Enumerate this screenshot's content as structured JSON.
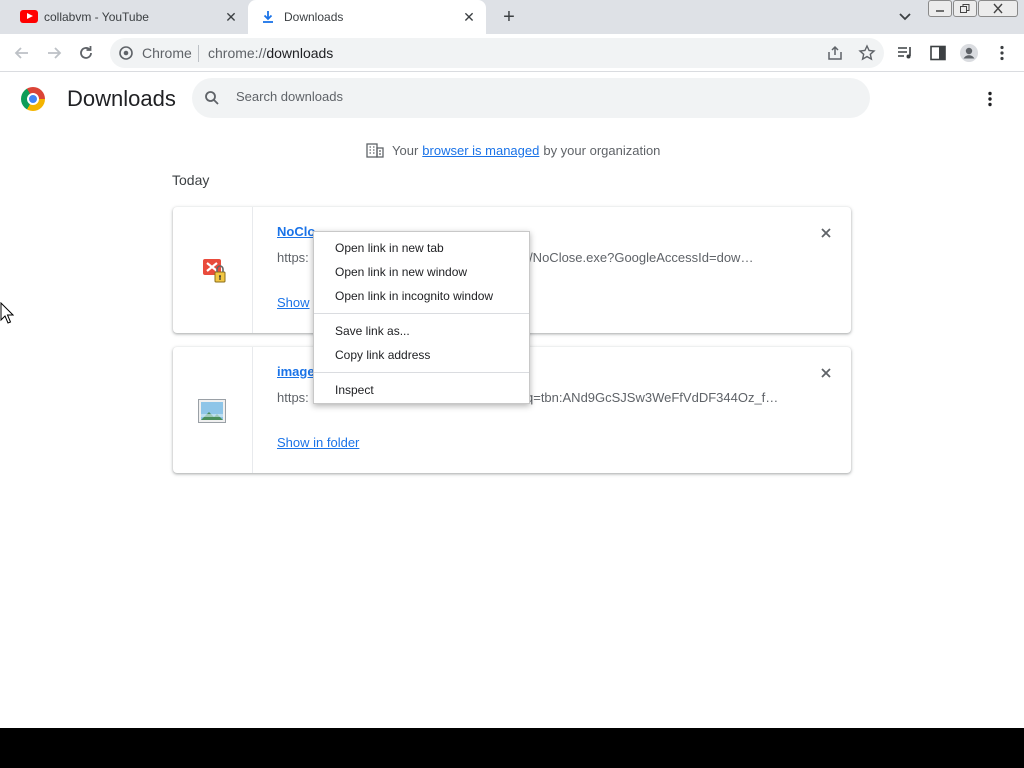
{
  "tabs": [
    {
      "title": "collabvm - YouTube",
      "icon": "youtube-icon"
    },
    {
      "title": "Downloads",
      "icon": "download-icon",
      "active": true
    }
  ],
  "toolbar": {
    "omnibox_label": "Chrome",
    "url_scheme": "chrome://",
    "url_host": "downloads"
  },
  "page": {
    "title": "Downloads",
    "search_placeholder": "Search downloads",
    "managed_prefix": "Your",
    "managed_link": "browser is managed",
    "managed_suffix": "by your organization",
    "section_label": "Today"
  },
  "downloads": [
    {
      "name": "NoClo",
      "url_head": "https:",
      "url_tail": "/61/NoClose.exe?GoogleAccessId=dow…",
      "action": "Show",
      "icon": "blocked-exe-icon"
    },
    {
      "name": "image",
      "url_head": "https:",
      "url_tail": "q=tbn:ANd9GcSJSw3WeFfVdDF344Oz_f…",
      "action": "Show in folder",
      "icon": "image-file-icon"
    }
  ],
  "context_menu": {
    "group1": [
      "Open link in new tab",
      "Open link in new window",
      "Open link in incognito window"
    ],
    "group2": [
      "Save link as...",
      "Copy link address"
    ],
    "group3": [
      "Inspect"
    ]
  },
  "colors": {
    "accent": "#1a73e8",
    "tabstrip": "#dee1e6",
    "omnibox": "#f1f3f4"
  }
}
